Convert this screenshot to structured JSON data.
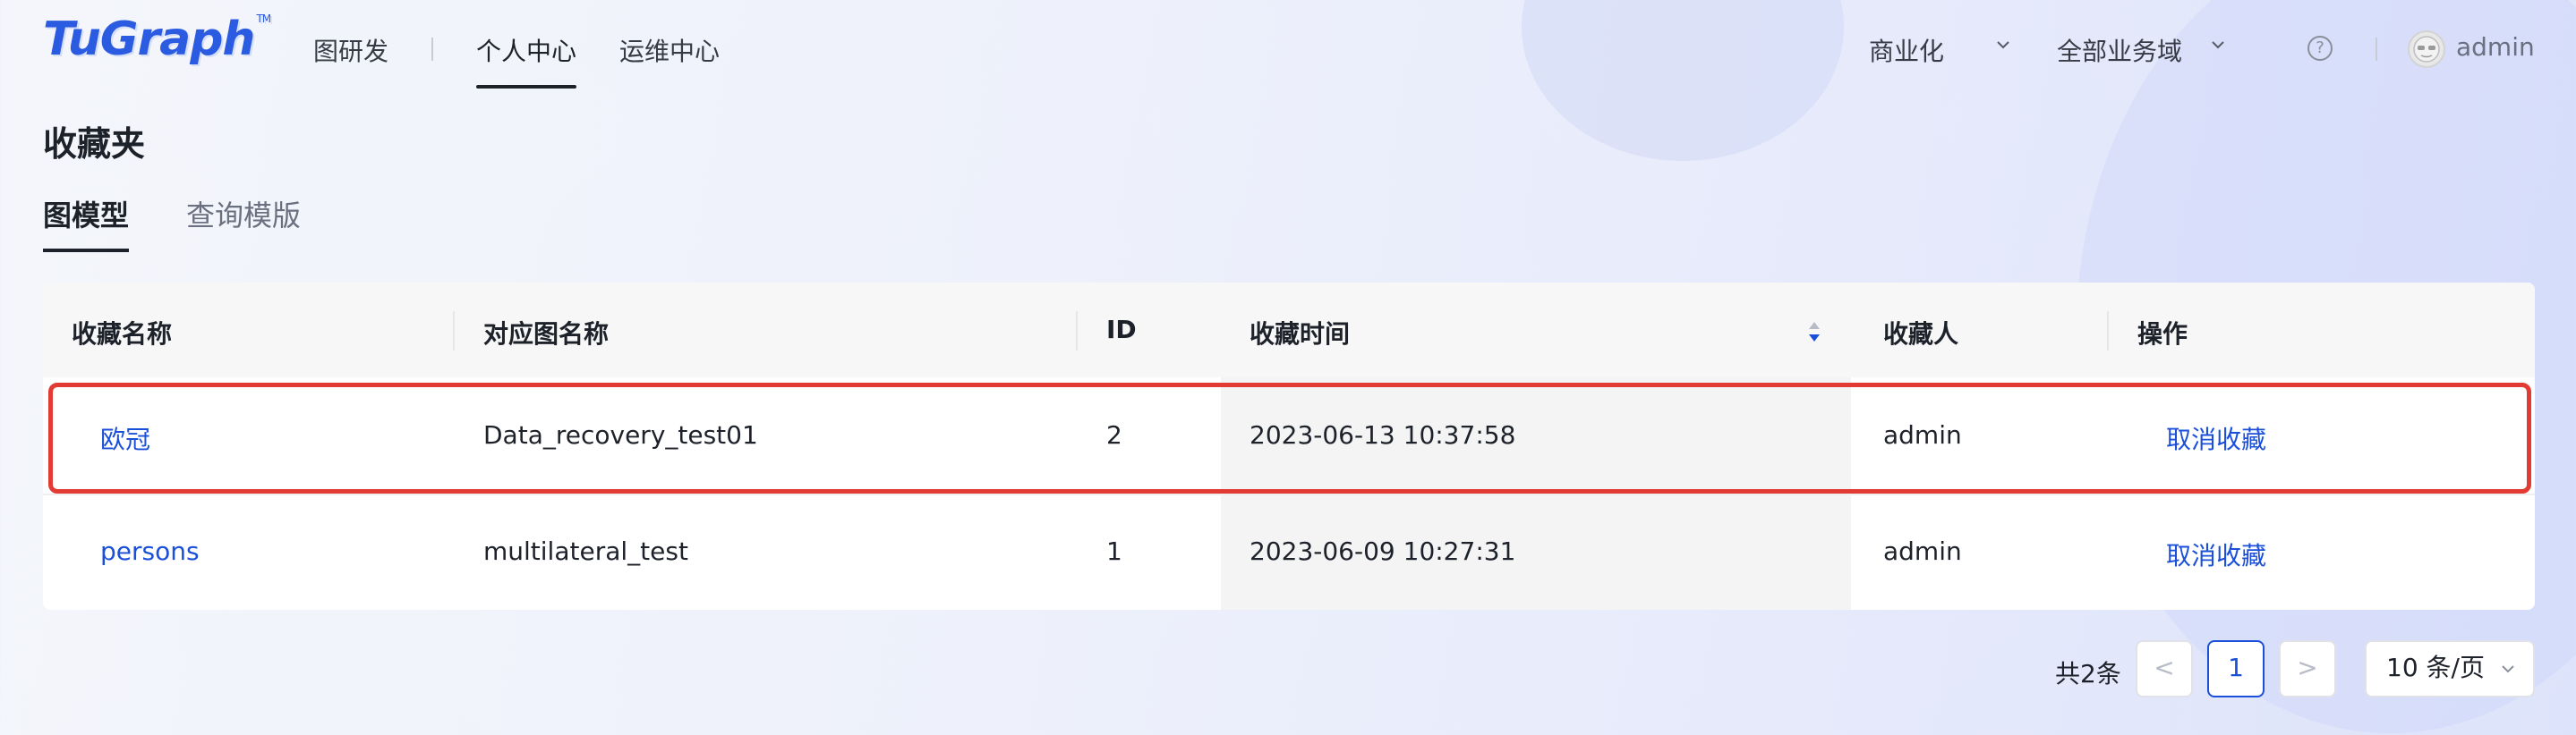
{
  "header": {
    "logo_text": "TuGraph",
    "logo_tm": "TM",
    "nav": [
      {
        "label": "图研发"
      },
      {
        "label": "个人中心"
      },
      {
        "label": "运维中心"
      }
    ],
    "right": {
      "commercial": "商业化",
      "domain": "全部业务域",
      "user": "admin"
    }
  },
  "page": {
    "title": "收藏夹",
    "tabs": [
      {
        "label": "图模型",
        "active": true
      },
      {
        "label": "查询模版",
        "active": false
      }
    ]
  },
  "table": {
    "columns": [
      "收藏名称",
      "对应图名称",
      "ID",
      "收藏时间",
      "收藏人",
      "操作"
    ],
    "rows": [
      {
        "name": "欧冠",
        "graph": "Data_recovery_test01",
        "id": "2",
        "time": "2023-06-13 10:37:58",
        "owner": "admin",
        "action": "取消收藏"
      },
      {
        "name": "persons",
        "graph": "multilateral_test",
        "id": "1",
        "time": "2023-06-09 10:27:31",
        "owner": "admin",
        "action": "取消收藏"
      }
    ]
  },
  "pagination": {
    "total": "共2条",
    "prev": "<",
    "current": "1",
    "next": ">",
    "page_size": "10 条/页"
  },
  "colors": {
    "accent": "#1a4fd9",
    "highlight": "#e23b33"
  }
}
